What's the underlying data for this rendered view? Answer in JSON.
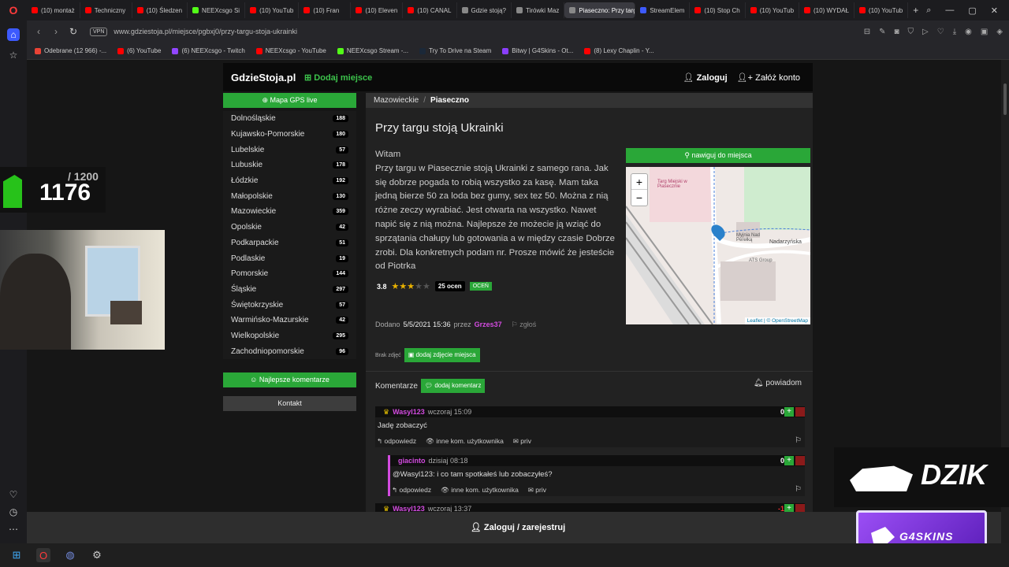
{
  "browser": {
    "tabs": [
      {
        "label": "(10) montaż",
        "color": "#ff0000"
      },
      {
        "label": "Techniczny",
        "color": "#ff0000"
      },
      {
        "label": "(10) Śledzen",
        "color": "#ff0000"
      },
      {
        "label": "NEEXcsgo Si",
        "color": "#53fc18"
      },
      {
        "label": "(10) YouTub",
        "color": "#ff0000"
      },
      {
        "label": "(10) Fran",
        "color": "#ff0000"
      },
      {
        "label": "(10) Eleven",
        "color": "#ff0000"
      },
      {
        "label": "(10) CANAL",
        "color": "#ff0000"
      },
      {
        "label": "Gdzie stoją?",
        "color": "#888888"
      },
      {
        "label": "Tirówki Maz",
        "color": "#888888"
      },
      {
        "label": "Piaseczno: Przy targu",
        "color": "#888888"
      },
      {
        "label": "StreamElem",
        "color": "#3d5afe"
      },
      {
        "label": "(10) Stop Ch",
        "color": "#ff0000"
      },
      {
        "label": "(10) YouTub",
        "color": "#ff0000"
      },
      {
        "label": "(10) WYDAŁ",
        "color": "#ff0000"
      },
      {
        "label": "(10) YouTub",
        "color": "#ff0000"
      }
    ],
    "active_tab": 10,
    "vpn_label": "VPN",
    "url": "www.gdziestoja.pl/miejsce/pgbxj0/przy-targu-stoja-ukrainki",
    "bookmarks": [
      {
        "label": "Odebrane (12 966) -...",
        "color": "#ea4335"
      },
      {
        "label": "(6) YouTube",
        "color": "#ff0000"
      },
      {
        "label": "(6) NEEXcsgo - Twitch",
        "color": "#9146ff"
      },
      {
        "label": "NEEXcsgo - YouTube",
        "color": "#ff0000"
      },
      {
        "label": "NEEXcsgo Stream -...",
        "color": "#53fc18"
      },
      {
        "label": "Try To Drive na Steam",
        "color": "#1b2838"
      },
      {
        "label": "Bitwy | G4Skins - Ot...",
        "color": "#8a3ffc"
      },
      {
        "label": "(8) Lexy Chaplin - Y...",
        "color": "#ff0000"
      }
    ]
  },
  "site": {
    "logo": "GdzieStoja.pl",
    "add_place": "Dodaj miejsce",
    "login": "Zaloguj",
    "register": "Załóż konto",
    "gps_button": "Mapa GPS live",
    "best_comments": "Najlepsze komentarze",
    "contact": "Kontakt",
    "regions": [
      {
        "name": "Dolnośląskie",
        "count": "188"
      },
      {
        "name": "Kujawsko-Pomorskie",
        "count": "180"
      },
      {
        "name": "Lubelskie",
        "count": "57"
      },
      {
        "name": "Lubuskie",
        "count": "178"
      },
      {
        "name": "Łódzkie",
        "count": "192"
      },
      {
        "name": "Małopolskie",
        "count": "130"
      },
      {
        "name": "Mazowieckie",
        "count": "359"
      },
      {
        "name": "Opolskie",
        "count": "42"
      },
      {
        "name": "Podkarpackie",
        "count": "51"
      },
      {
        "name": "Podlaskie",
        "count": "19"
      },
      {
        "name": "Pomorskie",
        "count": "144"
      },
      {
        "name": "Śląskie",
        "count": "297"
      },
      {
        "name": "Świętokrzyskie",
        "count": "57"
      },
      {
        "name": "Warmińsko-Mazurskie",
        "count": "42"
      },
      {
        "name": "Wielkopolskie",
        "count": "295"
      },
      {
        "name": "Zachodniopomorskie",
        "count": "96"
      }
    ],
    "breadcrumb": {
      "region": "Mazowieckie",
      "city": "Piaseczno"
    },
    "post": {
      "title": "Przy targu stoją Ukrainki",
      "greeting": "Witam",
      "body": "Przy targu w Piasecznie stoją Ukrainki z samego rana. Jak się dobrze pogada to robią wszystko za kasę. Mam taka jedną bierze 50 za loda bez gumy, sex tez 50. Można z nią różne zeczy wyrabiać. Jest otwarta na wszystko. Nawet napić się z nią można. Najlepsze że możecie ją wziąć do sprzątania chałupy lub gotowania a w między czasie Dobrze zrobi. Dla konkretnych podam nr. Prosze mówić że jesteście od Piotrka",
      "rating": "3.8",
      "stars": 3,
      "votes": "25 ocen",
      "rate_button": "OCEŃ",
      "added_label": "Dodano",
      "added_date": "5/5/2021 15:36",
      "by_label": "przez",
      "author": "Grzes37",
      "report": "zgłoś",
      "no_photo": "Brak zdjęć",
      "add_photo": "dodaj zdjęcie miejsca",
      "navigate": "nawiguj do miejsca"
    },
    "map": {
      "label_market": "Targ Miejski w Piasecznie",
      "label_wash": "Myjnia Nad Perełką",
      "label_street": "Nadarzyńska",
      "label_ats": "ATS Group",
      "attribution": "Leaflet | © OpenStreetMap",
      "zoom_in": "+",
      "zoom_out": "−"
    },
    "comments": {
      "header": "Komentarze",
      "add": "dodaj komentarz",
      "notify": "powiadom",
      "reply": "odpowiedz",
      "other": "inne kom. użytkownika",
      "priv": "priv",
      "items": [
        {
          "user": "Wasyl123",
          "time": "wczoraj 15:09",
          "score": "0",
          "text": "Jadę  zobaczyć"
        },
        {
          "user": "giacinto",
          "time": "dzisiaj 08:18",
          "score": "0",
          "text": "@Wasyl123: i co tam spotkałeś lub zobaczyłeś?"
        },
        {
          "user": "Wasyl123",
          "time": "wczoraj 13:37",
          "score": "-1"
        }
      ]
    },
    "bottom_bar": "Zaloguj / zarejestruj"
  },
  "overlay": {
    "counter_total": "/ 1200",
    "counter_value": "1176",
    "dzik": "DZIK",
    "g4skins": "G4SKINS"
  }
}
